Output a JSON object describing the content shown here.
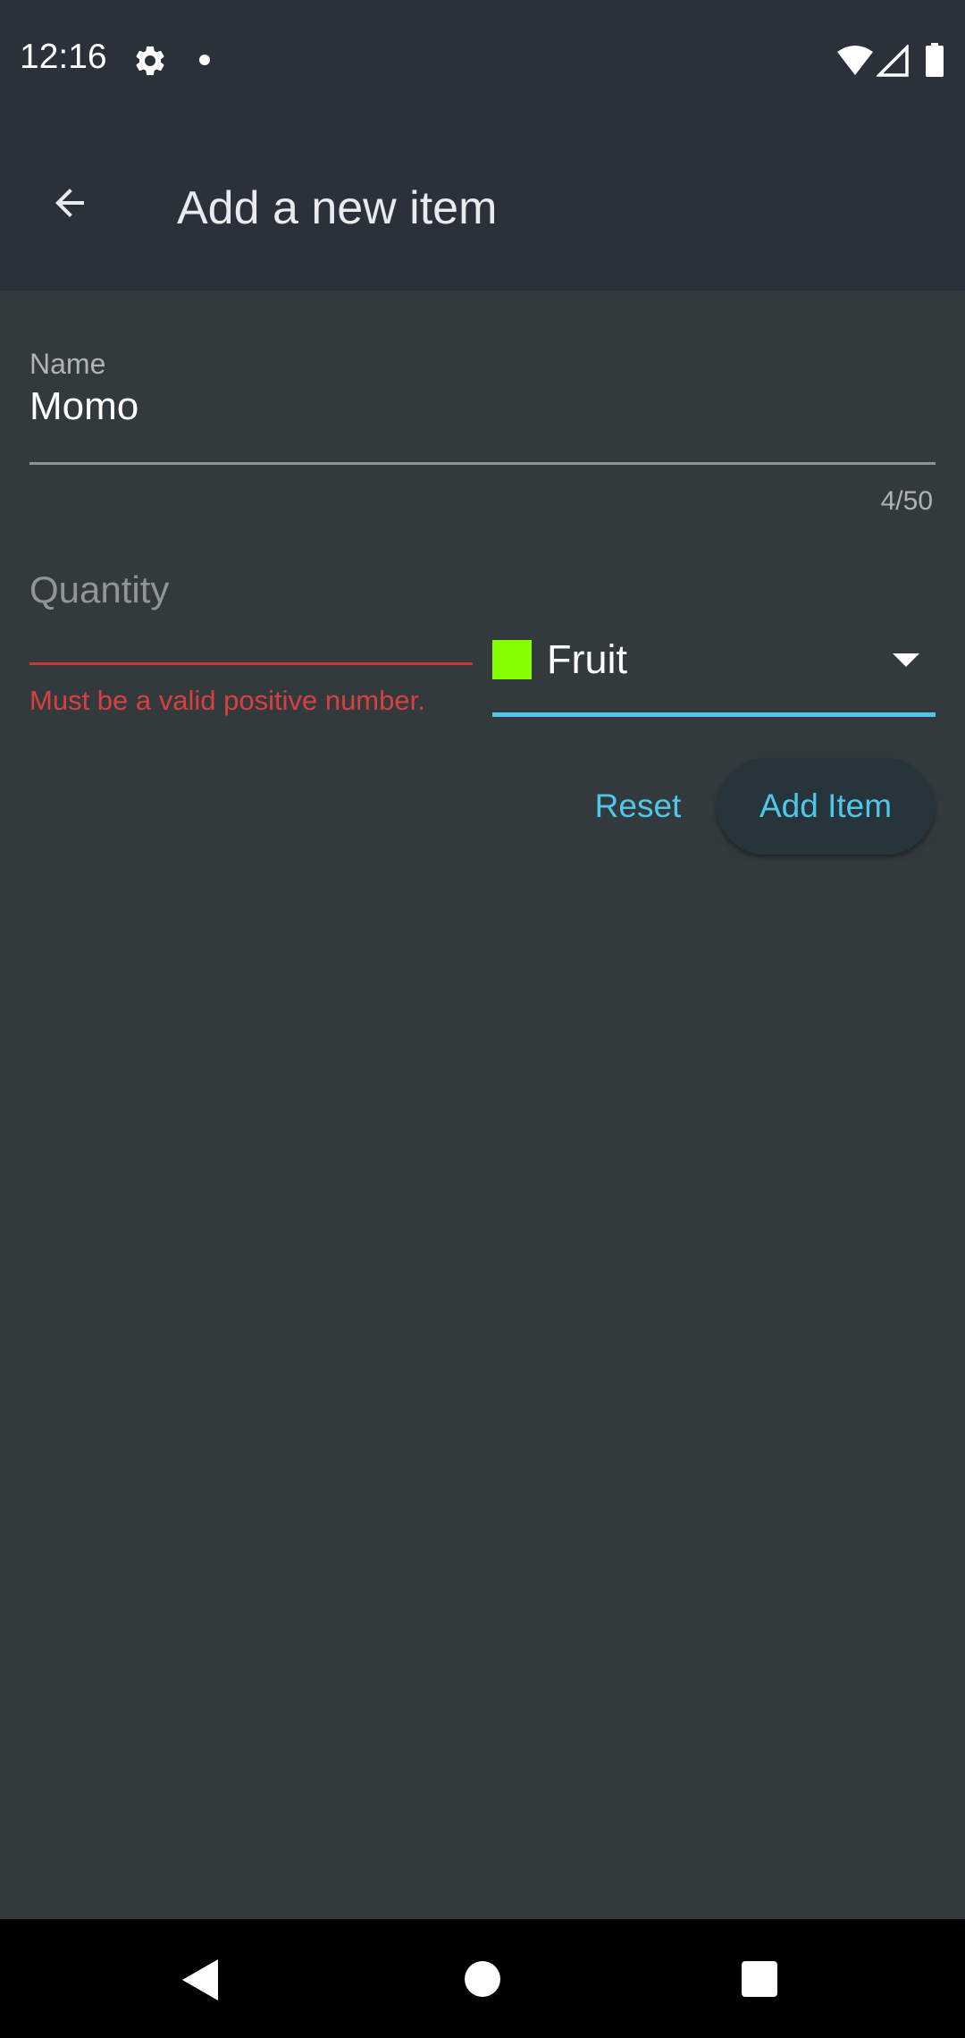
{
  "status_bar": {
    "time": "12:16",
    "icons": [
      "gear-icon",
      "notification-dot-icon",
      "wifi-icon",
      "signal-icon",
      "battery-icon"
    ]
  },
  "app_bar": {
    "title": "Add a new item",
    "back_icon": "arrow-back-icon"
  },
  "form": {
    "name": {
      "label": "Name",
      "value": "Momo",
      "counter": "4/50"
    },
    "quantity": {
      "label": "Quantity",
      "value": "",
      "error": "Must be a valid positive number."
    },
    "category": {
      "selected": "Fruit",
      "swatch_color": "#84ff00"
    },
    "reset_label": "Reset",
    "add_label": "Add Item"
  },
  "colors": {
    "accent": "#4fc7e8",
    "error": "#d8403f",
    "background": "#333a3d",
    "bar_background": "#2b313b"
  },
  "nav_bar": {
    "icons": [
      "nav-back-icon",
      "nav-home-icon",
      "nav-recents-icon"
    ]
  }
}
